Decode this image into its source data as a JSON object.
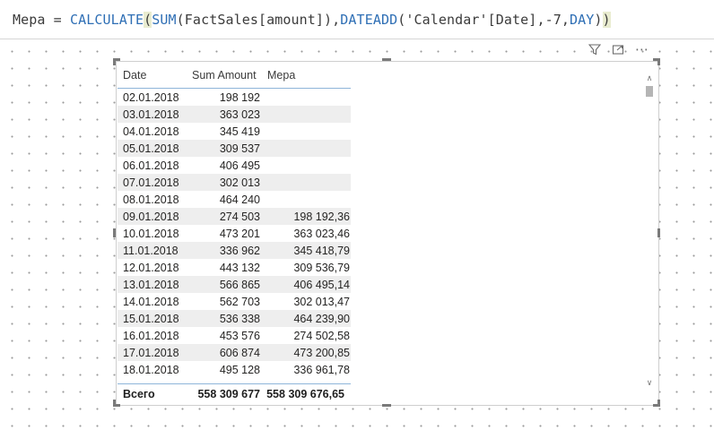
{
  "formula": {
    "measure_name": "Mepa",
    "equals": " = ",
    "f1": "CALCULATE",
    "p1": "(",
    "f2": "SUM",
    "t1": "(FactSales[amount]),",
    "f3": "DATEADD",
    "t2": "('Calendar'[Date],-7,",
    "f4": "DAY",
    "t3": ")",
    "p2": ")"
  },
  "visual_header": {
    "filter_icon": "filter-icon",
    "focus_icon": "focus-mode-icon",
    "more_icon": "more-options-icon",
    "more_glyph": "⋯"
  },
  "table": {
    "columns": [
      "Date",
      "Sum Amount",
      "Mepa"
    ],
    "rows": [
      {
        "date": "02.01.2018",
        "amount": "198 192",
        "mepa": ""
      },
      {
        "date": "03.01.2018",
        "amount": "363 023",
        "mepa": ""
      },
      {
        "date": "04.01.2018",
        "amount": "345 419",
        "mepa": ""
      },
      {
        "date": "05.01.2018",
        "amount": "309 537",
        "mepa": ""
      },
      {
        "date": "06.01.2018",
        "amount": "406 495",
        "mepa": ""
      },
      {
        "date": "07.01.2018",
        "amount": "302 013",
        "mepa": ""
      },
      {
        "date": "08.01.2018",
        "amount": "464 240",
        "mepa": ""
      },
      {
        "date": "09.01.2018",
        "amount": "274 503",
        "mepa": "198 192,36"
      },
      {
        "date": "10.01.2018",
        "amount": "473 201",
        "mepa": "363 023,46"
      },
      {
        "date": "11.01.2018",
        "amount": "336 962",
        "mepa": "345 418,79"
      },
      {
        "date": "12.01.2018",
        "amount": "443 132",
        "mepa": "309 536,79"
      },
      {
        "date": "13.01.2018",
        "amount": "566 865",
        "mepa": "406 495,14"
      },
      {
        "date": "14.01.2018",
        "amount": "562 703",
        "mepa": "302 013,47"
      },
      {
        "date": "15.01.2018",
        "amount": "536 338",
        "mepa": "464 239,90"
      },
      {
        "date": "16.01.2018",
        "amount": "453 576",
        "mepa": "274 502,58"
      },
      {
        "date": "17.01.2018",
        "amount": "606 874",
        "mepa": "473 200,85"
      },
      {
        "date": "18.01.2018",
        "amount": "495 128",
        "mepa": "336 961,78"
      }
    ],
    "total": {
      "label": "Всего",
      "amount": "558 309 677",
      "mepa": "558 309 676,65"
    }
  },
  "scrollbar": {
    "up": "∧",
    "down": "∨"
  }
}
